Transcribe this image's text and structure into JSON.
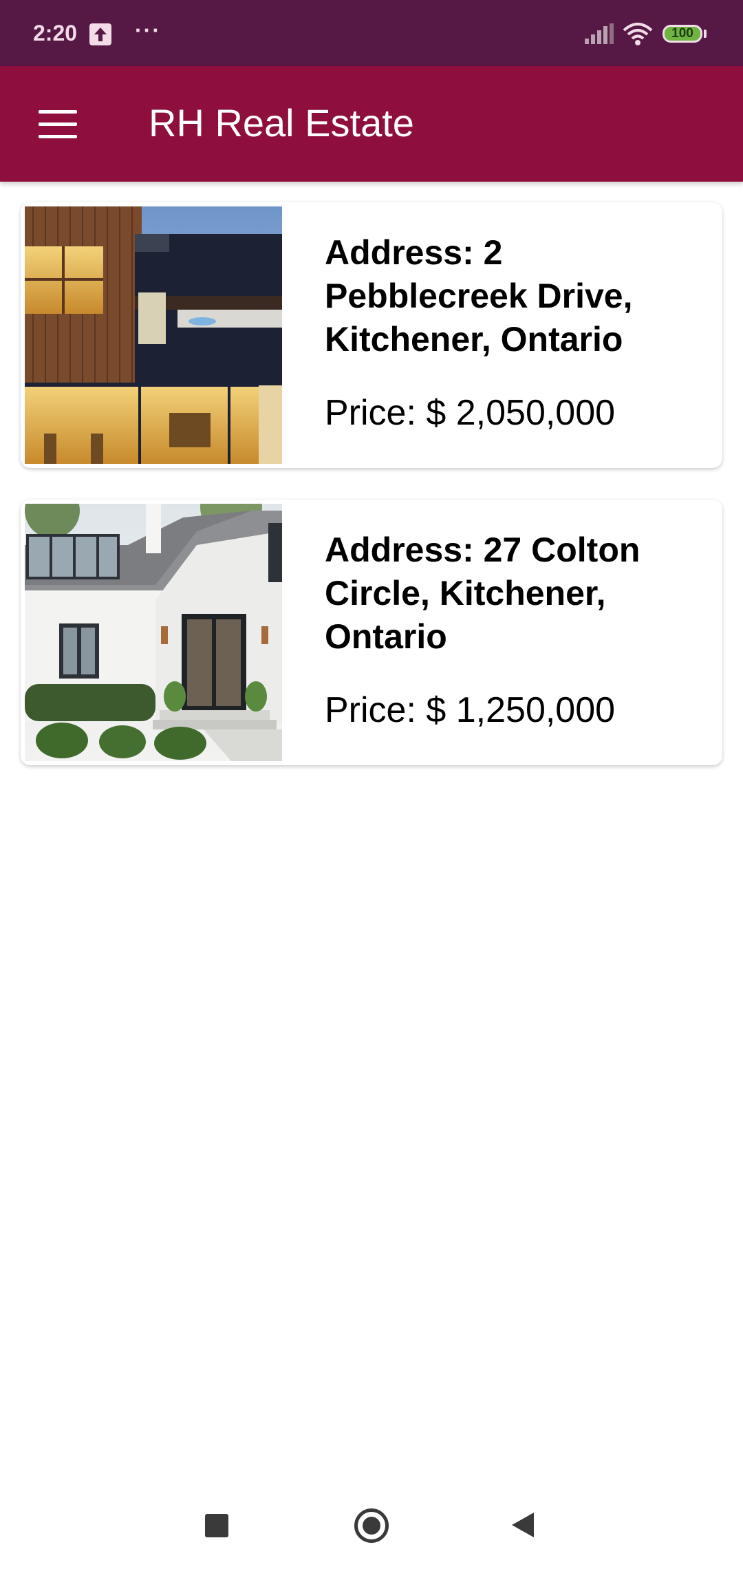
{
  "status_bar": {
    "time": "2:20",
    "upload_icon": "upload-icon",
    "more": "···",
    "signal_icon": "signal-icon",
    "wifi_icon": "wifi-icon",
    "battery": "100",
    "battery_color": "#6fb342"
  },
  "app_bar": {
    "title": "RH Real Estate",
    "menu_icon": "hamburger-menu-icon",
    "background": "#8e0e3d"
  },
  "listings": [
    {
      "address": "Address: 2 Pebblecreek Drive, Kitchener, Ontario",
      "price": "Price: $ 2,050,000",
      "photo": "modern-house-photo"
    },
    {
      "address": "Address: 27 Colton Circle, Kitchener, Ontario",
      "price": "Price: $ 1,250,000",
      "photo": "white-house-photo"
    }
  ],
  "nav_bar": {
    "recents_icon": "recents-square-icon",
    "home_icon": "home-circle-icon",
    "back_icon": "back-triangle-icon"
  }
}
